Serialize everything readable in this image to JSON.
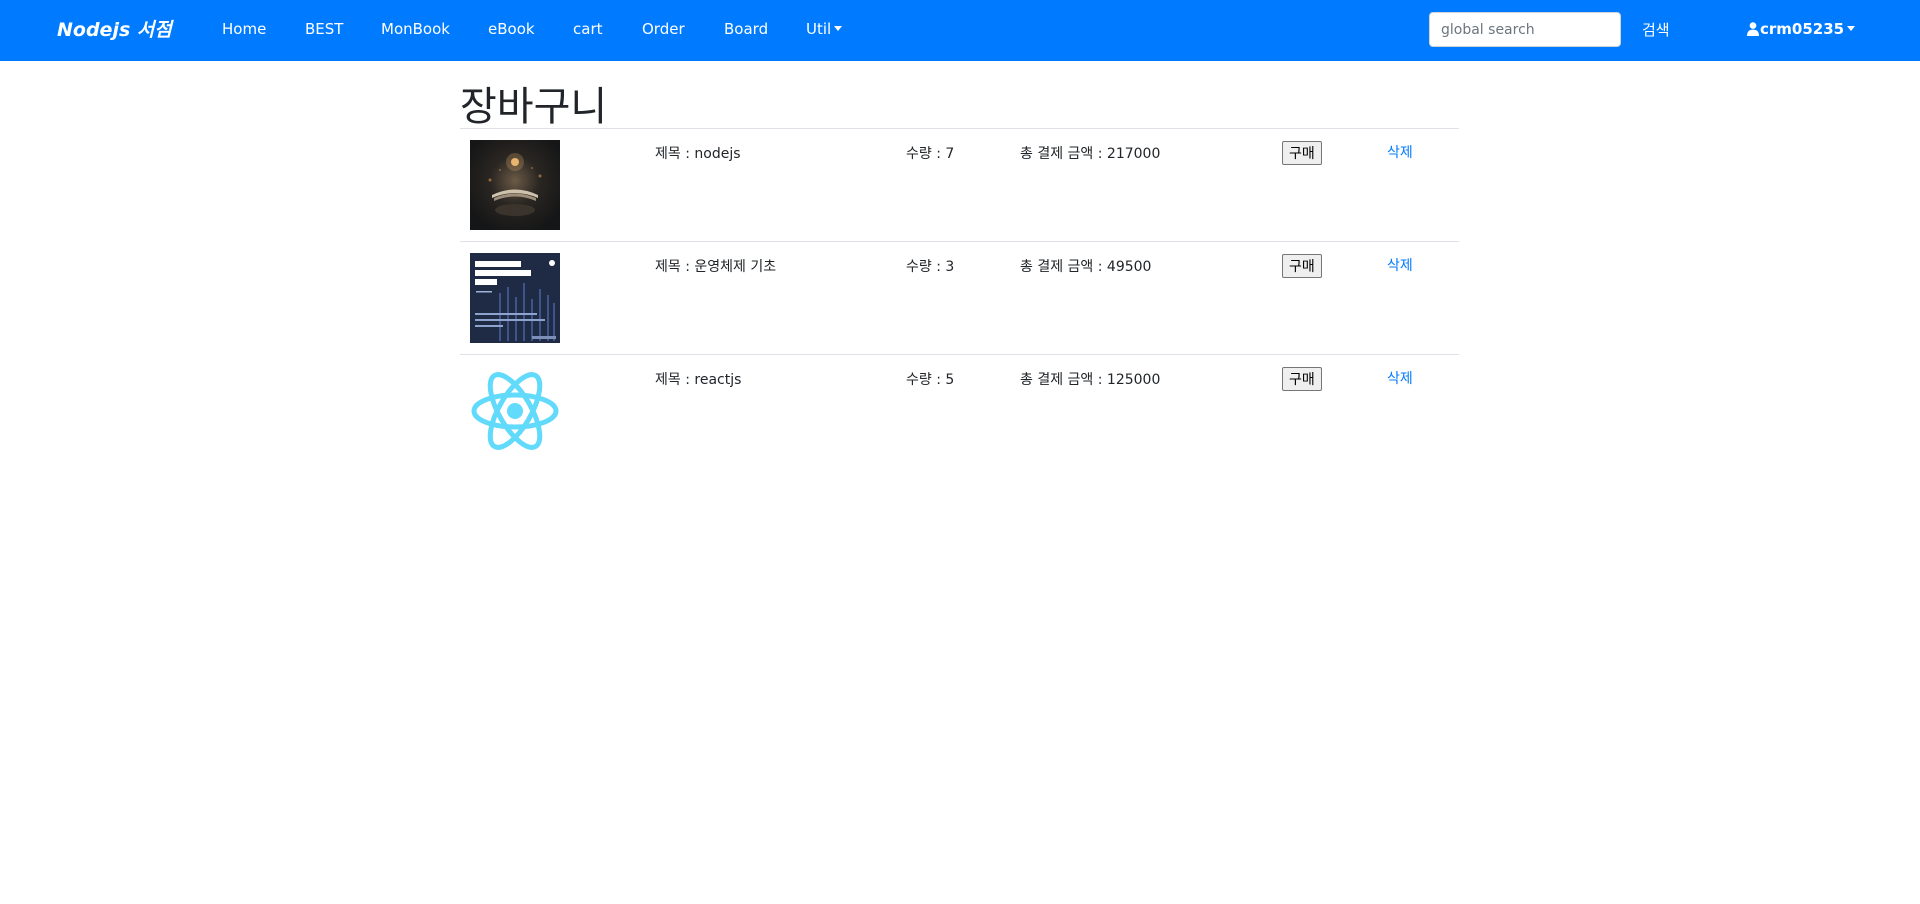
{
  "navbar": {
    "brand": "Nodejs 서점",
    "links": [
      "Home",
      "BEST",
      "MonBook",
      "eBook",
      "cart",
      "Order",
      "Board"
    ],
    "util_label": "Util",
    "search_placeholder": "global search",
    "search_button": "검색",
    "username": "crm05235",
    "bg_color": "#007bff"
  },
  "page": {
    "title": "장바구니"
  },
  "cart": {
    "items": [
      {
        "thumb": "dark-book-cover",
        "title": "제목 : nodejs",
        "qty": "수량 : 7",
        "total": "총 결제 금액 : 217000",
        "buy": "구매",
        "delete": "삭제"
      },
      {
        "thumb": "os-book-cover",
        "title": "제목 : 운영체제 기초",
        "qty": "수량 : 3",
        "total": "총 결제 금액 : 49500",
        "buy": "구매",
        "delete": "삭제"
      },
      {
        "thumb": "react-logo",
        "title": "제목 : reactjs",
        "qty": "수량 : 5",
        "total": "총 결제 금액 : 125000",
        "buy": "구매",
        "delete": "삭제"
      }
    ]
  }
}
